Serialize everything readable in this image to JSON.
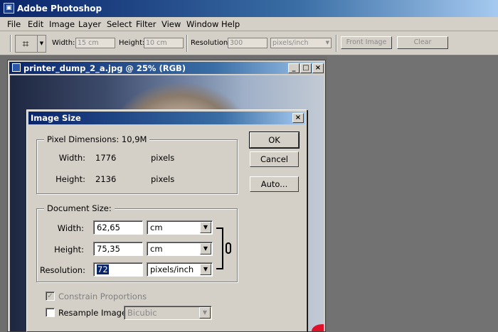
{
  "app": {
    "title": "Adobe Photoshop",
    "icon": "ps"
  },
  "menu": [
    "File",
    "Edit",
    "Image",
    "Layer",
    "Select",
    "Filter",
    "View",
    "Window",
    "Help"
  ],
  "options": {
    "width_label": "Width:",
    "width_value": "15 cm",
    "height_label": "Height:",
    "height_value": "10 cm",
    "resolution_label": "Resolution:",
    "resolution_value": "300",
    "resolution_unit": "pixels/inch",
    "front_image": "Front Image",
    "clear": "Clear"
  },
  "document": {
    "title": "printer_dump_2_a.jpg @ 25% (RGB)"
  },
  "dialog": {
    "title": "Image Size",
    "pixel_dimensions": {
      "label": "Pixel Dimensions:",
      "value": "10,9M",
      "width_label": "Width:",
      "width_value": "1776",
      "width_unit": "pixels",
      "height_label": "Height:",
      "height_value": "2136",
      "height_unit": "pixels"
    },
    "document_size": {
      "label": "Document Size:",
      "width_label": "Width:",
      "width_value": "62,65",
      "width_unit": "cm",
      "height_label": "Height:",
      "height_value": "75,35",
      "height_unit": "cm",
      "resolution_label": "Resolution:",
      "resolution_value": "72",
      "resolution_unit": "pixels/inch"
    },
    "constrain_label": "Constrain Proportions",
    "resample_label": "Resample Image:",
    "resample_value": "Bicubic",
    "ok": "OK",
    "cancel": "Cancel",
    "auto": "Auto..."
  }
}
